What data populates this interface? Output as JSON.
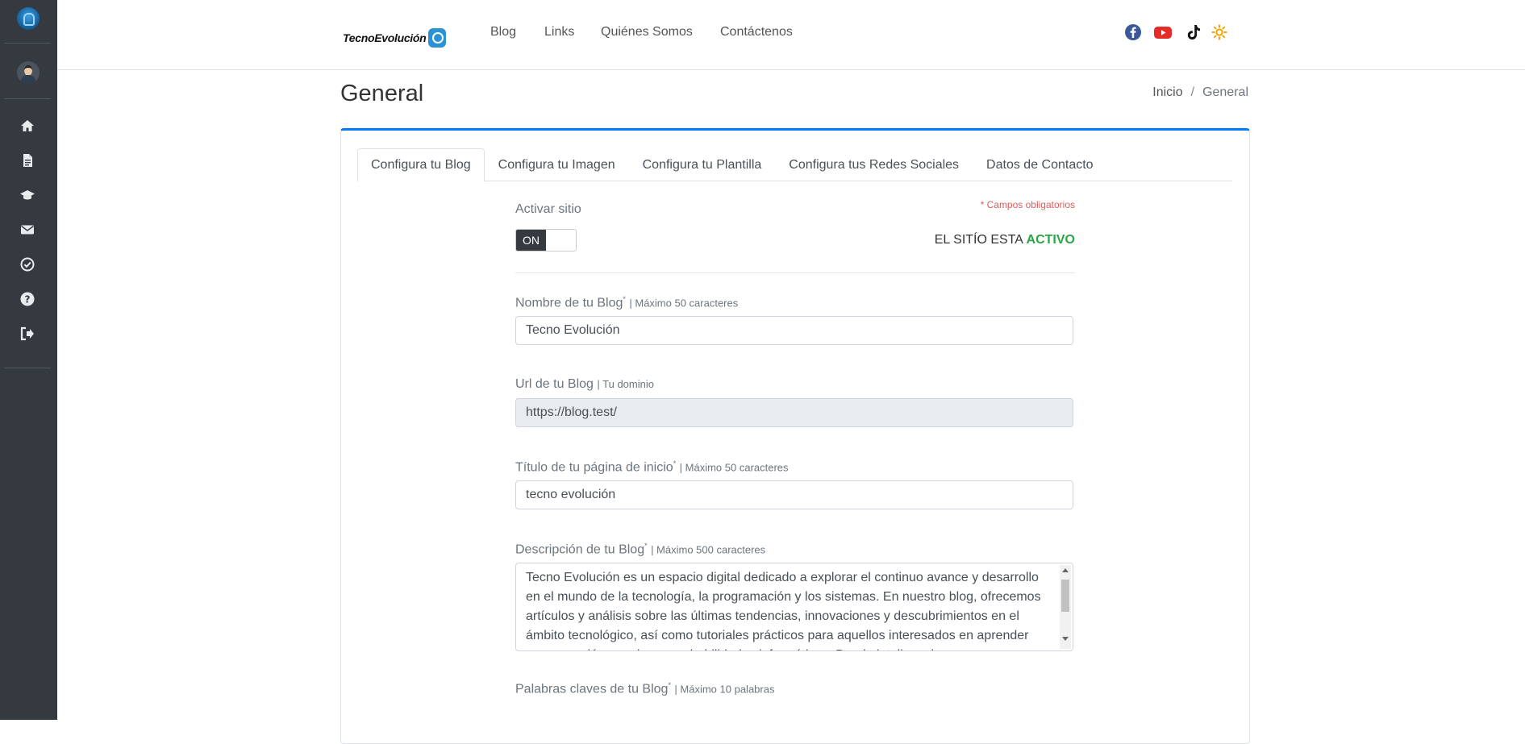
{
  "sidebar": {
    "logo_icon": "tecno-logo-icon",
    "avatar_icon": "user-avatar",
    "items": [
      {
        "name": "home-icon"
      },
      {
        "name": "file-icon"
      },
      {
        "name": "graduation-cap-icon"
      },
      {
        "name": "envelope-icon"
      },
      {
        "name": "check-circle-icon"
      },
      {
        "name": "question-circle-icon"
      },
      {
        "name": "sign-out-icon"
      }
    ]
  },
  "header": {
    "brand": "TecnoEvolución",
    "nav": [
      "Blog",
      "Links",
      "Quiénes Somos",
      "Contáctenos"
    ],
    "social": [
      "facebook-icon",
      "youtube-icon",
      "tiktok-icon",
      "sun-icon"
    ]
  },
  "page": {
    "title": "General",
    "breadcrumb": [
      "Inicio",
      "/",
      "General"
    ]
  },
  "tabs": [
    "Configura tu Blog",
    "Configura tu Imagen",
    "Configura tu Plantilla",
    "Configura tus Redes Sociales",
    "Datos de Contacto"
  ],
  "form": {
    "required_note": "* Campos obligatorios",
    "activate_label": "Activar sitio",
    "switch_label": "ON",
    "status_prefix": "EL SITÍO ESTA",
    "status_value": "ACTIVO",
    "blog_name": {
      "label": "Nombre de tu Blog",
      "req": "*",
      "hint": "| Máximo 50 caracteres",
      "value": "Tecno Evolución"
    },
    "blog_url": {
      "label": "Url de tu Blog",
      "hint": "| Tu dominio",
      "value": "https://blog.test/"
    },
    "home_title": {
      "label": "Título de tu página de inicio",
      "req": "*",
      "hint": "| Máximo 50 caracteres",
      "value": "tecno evolución"
    },
    "description": {
      "label": "Descripción de tu Blog",
      "req": "*",
      "hint": "| Máximo 500 caracteres",
      "value": "Tecno Evolución es un espacio digital dedicado a explorar el continuo avance y desarrollo en el mundo de la tecnología, la programación y los sistemas. En nuestro blog, ofrecemos artículos y análisis sobre las últimas tendencias, innovaciones y descubrimientos en el ámbito tecnológico, así como tutoriales prácticos para aquellos interesados en aprender programación o mejorar sus habilidades informáticas. Desde inteligencia"
    },
    "keywords": {
      "label": "Palabras claves de tu Blog",
      "req": "*",
      "hint": "| Máximo 10 palabras"
    }
  },
  "colors": {
    "sidebar": "#343a40",
    "accent": "#007bff",
    "active": "#28a745",
    "required": "#e05a5a"
  }
}
